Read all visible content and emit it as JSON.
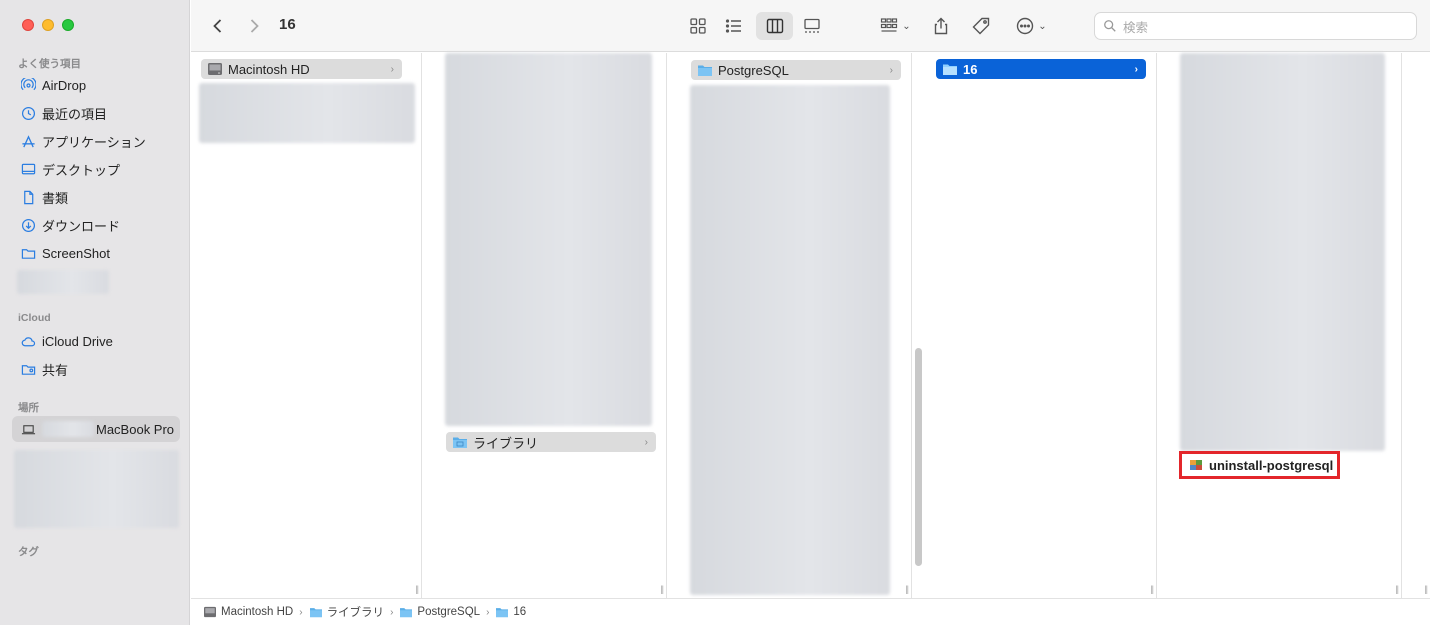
{
  "toolbar": {
    "title": "16",
    "search_placeholder": "検索"
  },
  "sidebar": {
    "sections": {
      "favorites": "よく使う項目",
      "icloud": "iCloud",
      "locations": "場所",
      "tags": "タグ"
    },
    "favorites": [
      {
        "label": "AirDrop",
        "icon": "airdrop-icon"
      },
      {
        "label": "最近の項目",
        "icon": "clock-icon"
      },
      {
        "label": "アプリケーション",
        "icon": "applications-icon"
      },
      {
        "label": "デスクトップ",
        "icon": "desktop-icon"
      },
      {
        "label": "書類",
        "icon": "document-icon"
      },
      {
        "label": "ダウンロード",
        "icon": "download-icon"
      },
      {
        "label": "ScreenShot",
        "icon": "folder-icon"
      }
    ],
    "icloud": [
      {
        "label": "iCloud Drive",
        "icon": "cloud-icon"
      },
      {
        "label": "共有",
        "icon": "shared-folder-icon"
      }
    ],
    "locations": [
      {
        "label": "MacBook Pro",
        "icon": "laptop-icon"
      }
    ]
  },
  "columns": {
    "col1": {
      "selected": "Macintosh HD"
    },
    "col2": {
      "selected": "ライブラリ"
    },
    "col3": {
      "selected": "PostgreSQL"
    },
    "col4": {
      "selected": "16"
    },
    "col5": {
      "file": "uninstall-postgresql"
    }
  },
  "pathbar": [
    "Macintosh HD",
    "ライブラリ",
    "PostgreSQL",
    "16"
  ],
  "colors": {
    "selection_blue": "#0a63d8",
    "highlight_red": "#e3262b",
    "folder_blue": "#5aaee8"
  }
}
